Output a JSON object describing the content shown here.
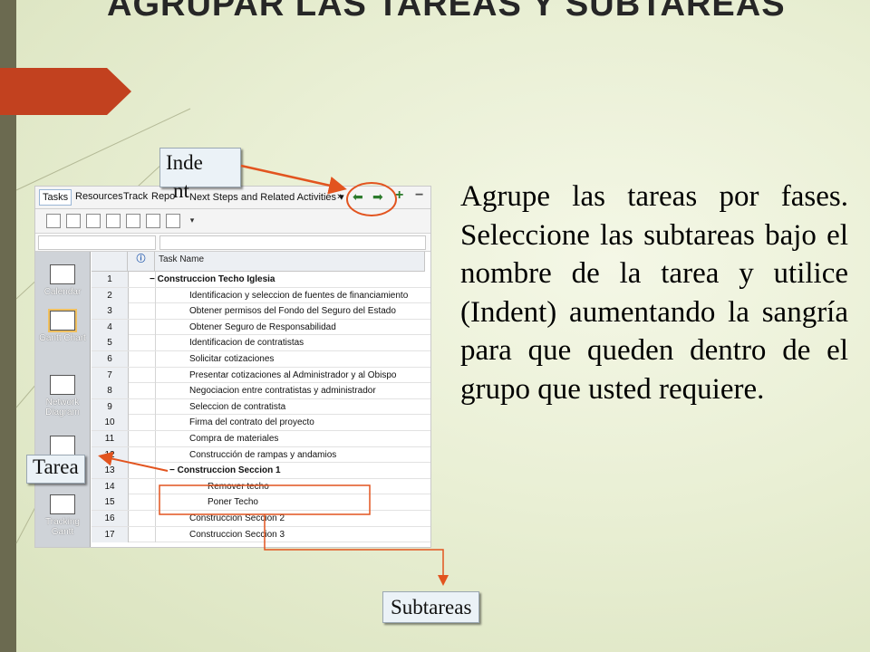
{
  "slide": {
    "title": "AGRUPAR LAS TAREAS Y SUBTAREAS",
    "body": "Agrupe las tareas por fases. Seleccione las subtareas bajo el nombre de la tarea y utilice (Indent) aumentando la sangría para que queden dentro de el grupo que usted requiere."
  },
  "callouts": {
    "indent_line1": "Inde",
    "indent_line2": "nt",
    "tarea": "Tarea",
    "subtareas": "Subtareas"
  },
  "project": {
    "menu": {
      "tasks": "Tasks",
      "resources": "Resources",
      "track": "Track",
      "report": "Repo",
      "next_steps": "Next Steps and Related Activities",
      "overflow": "»"
    },
    "column_task_name": "Task Name",
    "views": [
      {
        "label": "Calendar",
        "icon": "calendar-icon"
      },
      {
        "label": "Gantt Chart",
        "icon": "gantt-chart-icon"
      },
      {
        "label": "Network Diagram",
        "icon": "network-diagram-icon"
      },
      {
        "label": "",
        "icon": "task-usage-icon"
      },
      {
        "label": "Tracking Gantt",
        "icon": "tracking-gantt-icon"
      }
    ],
    "rows": [
      {
        "id": "1",
        "name": "Construccion Techo Iglesia",
        "level": 0,
        "summary": true
      },
      {
        "id": "2",
        "name": "Identificacion y seleccion  de fuentes de financiamiento",
        "level": 1,
        "summary": false
      },
      {
        "id": "3",
        "name": "Obtener permisos del Fondo del Seguro del Estado",
        "level": 1,
        "summary": false
      },
      {
        "id": "4",
        "name": "Obtener Seguro de Responsabilidad",
        "level": 1,
        "summary": false
      },
      {
        "id": "5",
        "name": "Identificacion de contratistas",
        "level": 1,
        "summary": false
      },
      {
        "id": "6",
        "name": "Solicitar cotizaciones",
        "level": 1,
        "summary": false
      },
      {
        "id": "7",
        "name": "Presentar cotizaciones al Administrador y al Obispo",
        "level": 1,
        "summary": false
      },
      {
        "id": "8",
        "name": "Negociacion entre contratistas y administrador",
        "level": 1,
        "summary": false
      },
      {
        "id": "9",
        "name": "Seleccion de contratista",
        "level": 1,
        "summary": false
      },
      {
        "id": "10",
        "name": "Firma del contrato del proyecto",
        "level": 1,
        "summary": false
      },
      {
        "id": "11",
        "name": "Compra de materiales",
        "level": 1,
        "summary": false
      },
      {
        "id": "12",
        "name": "Construcción de rampas y andamios",
        "level": 1,
        "summary": false
      },
      {
        "id": "13",
        "name": "Construccion Seccion 1",
        "level": 1,
        "summary": true
      },
      {
        "id": "14",
        "name": "Remover techo",
        "level": 2,
        "summary": false
      },
      {
        "id": "15",
        "name": "Poner Techo",
        "level": 2,
        "summary": false
      },
      {
        "id": "16",
        "name": "Construccion Seccion 2",
        "level": 1,
        "summary": false
      },
      {
        "id": "17",
        "name": "Construccion Seccion 3",
        "level": 1,
        "summary": false
      }
    ]
  },
  "colors": {
    "accent": "#c2411f",
    "callout_arrow": "#e2541f",
    "highlight": "#e2541f"
  }
}
